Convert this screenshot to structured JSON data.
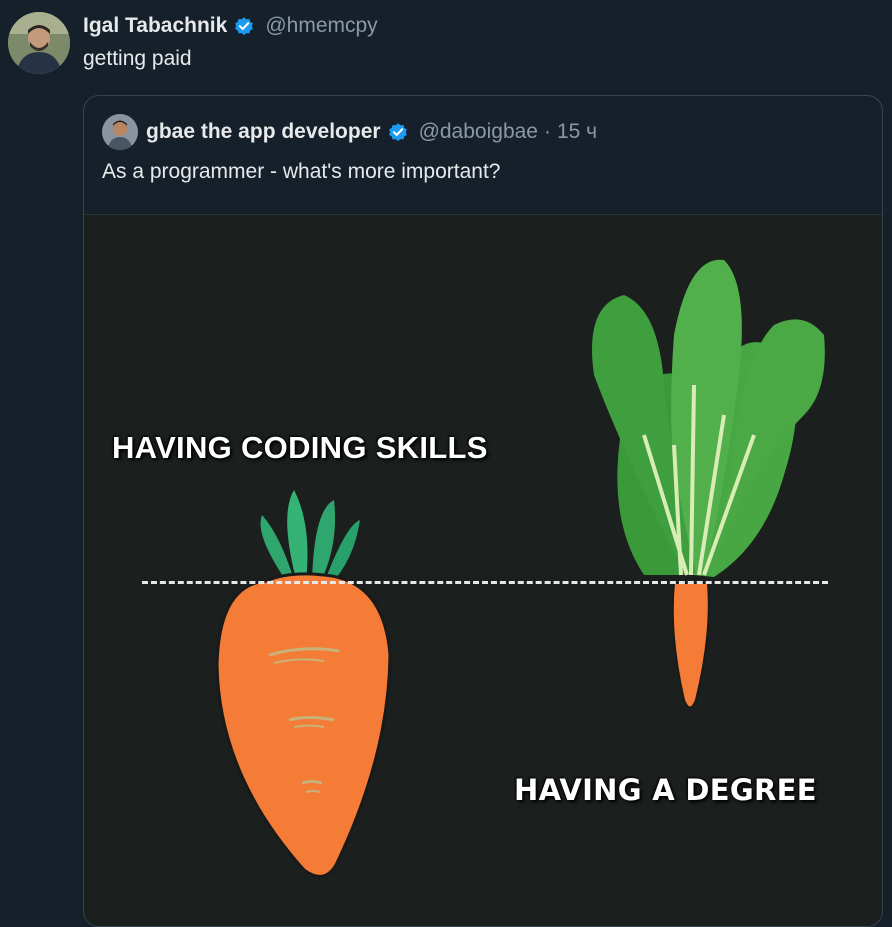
{
  "tweet": {
    "author": "Igal Tabachnik",
    "handle": "@hmemcpy",
    "text": "getting paid",
    "verified_color": "#1d9bf0"
  },
  "quote": {
    "author": "gbae the app developer",
    "handle": "@daboigbae",
    "separator": "·",
    "time": "15 ч",
    "text": "As a programmer - what's more important?",
    "media": {
      "label_left": "HAVING CODING SKILLS",
      "label_right": "HAVING  A DEGREE"
    }
  },
  "colors": {
    "background": "#15202b",
    "text": "#e7e9ea",
    "muted": "#8b98a5",
    "carrot": "#f47c36",
    "leaf": "#2fa66d"
  }
}
